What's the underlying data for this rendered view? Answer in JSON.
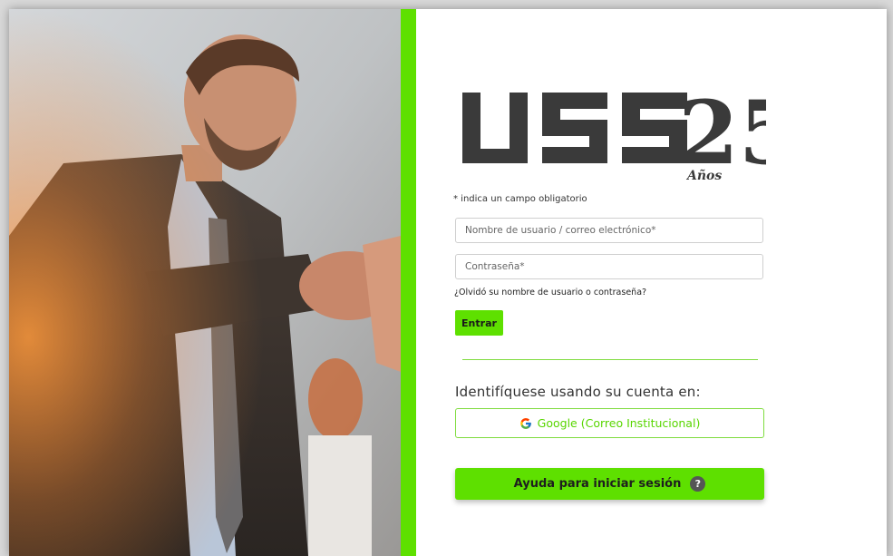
{
  "logo": {
    "brand": "USS",
    "number": "25",
    "subtitle": "Años"
  },
  "form": {
    "required_note": "* indica un campo obligatorio",
    "username_placeholder": "Nombre de usuario / correo electrónico*",
    "password_placeholder": "Contraseña*",
    "forgot_link": "¿Olvidó su nombre de usuario o contraseña?",
    "submit_label": "Entrar"
  },
  "federated": {
    "heading": "Identifíquese usando su cuenta en:",
    "google_label": "Google (Correo Institucional)"
  },
  "help": {
    "label": "Ayuda para iniciar sesión",
    "icon_glyph": "?"
  },
  "colors": {
    "accent_green": "#5ee000",
    "logo_gray": "#3a3a3a"
  }
}
